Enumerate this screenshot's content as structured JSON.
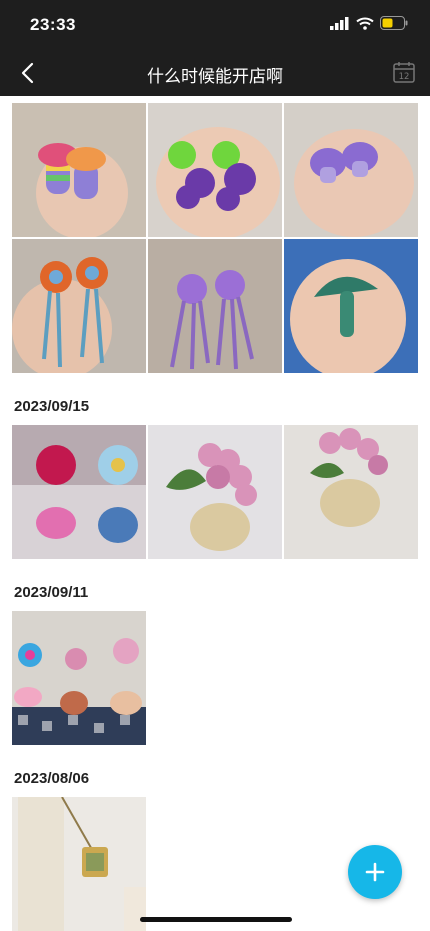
{
  "status_bar": {
    "time": "23:33"
  },
  "header": {
    "title": "什么时候能开店啊",
    "calendar_day": "12"
  },
  "sections": [
    {
      "date": "",
      "photos": [
        "rainbow crochet mushroom earrings",
        "green and purple flower earrings",
        "purple crochet mushroom earrings",
        "orange flower tassel earrings",
        "purple flower tassel earrings",
        "green crochet mushroom"
      ]
    },
    {
      "date": "2023/09/15",
      "photos": [
        "crochet rose and sunflower pots",
        "pink hydrangea pot",
        "pink hydrangea pot"
      ]
    },
    {
      "date": "2023/09/11",
      "photos": [
        "crochet flower pots set"
      ]
    },
    {
      "date": "2023/08/06",
      "photos": [
        "crochet phone bag"
      ]
    }
  ],
  "colors": {
    "bar": "#1e1e1e",
    "fab": "#16b7e8"
  }
}
